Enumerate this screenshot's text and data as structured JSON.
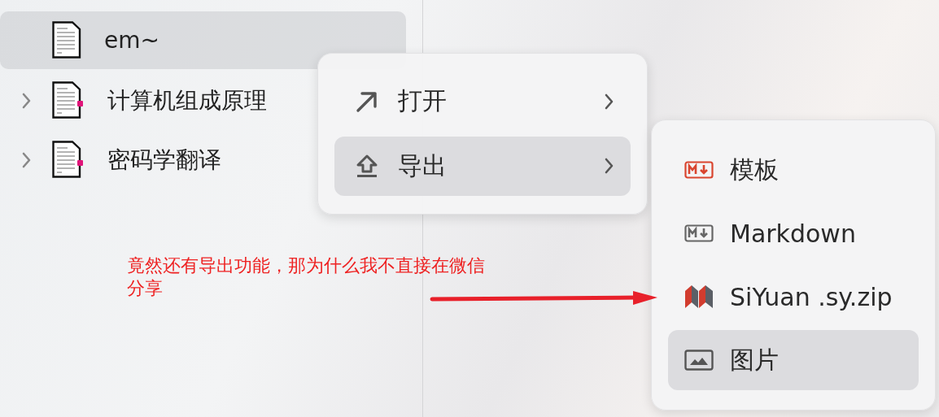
{
  "tree": {
    "items": [
      {
        "label": "em~",
        "has_children": false,
        "selected": true
      },
      {
        "label": "计算机组成原理",
        "has_children": true,
        "selected": false
      },
      {
        "label": "密码学翻译",
        "has_children": true,
        "selected": false
      }
    ]
  },
  "context_menu": {
    "items": [
      {
        "label": "打开",
        "kind": "arrow",
        "submenu": true,
        "selected": false
      },
      {
        "label": "导出",
        "kind": "upload",
        "submenu": true,
        "selected": true
      }
    ]
  },
  "export_menu": {
    "items": [
      {
        "label": "模板",
        "kind": "markdown-accent",
        "selected": false
      },
      {
        "label": "Markdown",
        "kind": "markdown",
        "selected": false
      },
      {
        "label": "SiYuan .sy.zip",
        "kind": "siyuan",
        "selected": false
      },
      {
        "label": "图片",
        "kind": "image",
        "selected": true
      }
    ]
  },
  "annotation": {
    "text": "竟然还有导出功能，那为什么我不直接在微信分享"
  }
}
